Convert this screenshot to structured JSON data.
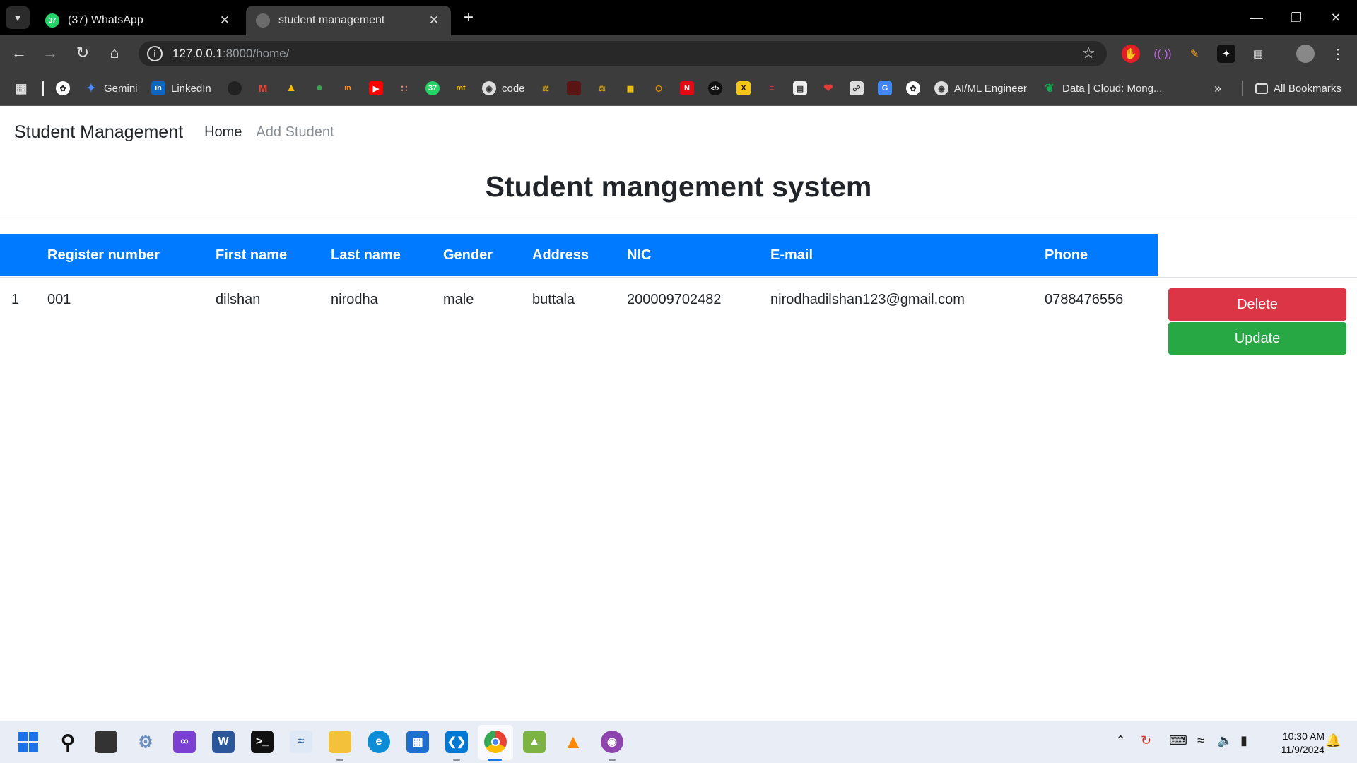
{
  "browser": {
    "tabs": [
      {
        "title": "(37) WhatsApp",
        "favicon_badge": "37",
        "favicon_color": "#25d366"
      },
      {
        "title": "student management",
        "favicon_color": "#777777"
      }
    ],
    "url_host": "127.0.0.1",
    "url_rest": ":8000/home/",
    "bookmarks": [
      {
        "label": "Gemini",
        "icon": "gemini-icon",
        "color": "#4a8cff"
      },
      {
        "label": "LinkedIn",
        "icon": "linkedin-icon",
        "color": "#0a66c2"
      },
      {
        "label": "code",
        "icon": "code-globe-icon",
        "color": "#dddddd"
      },
      {
        "label": "AI/ML Engineer",
        "icon": "ai-ml-icon",
        "color": "#dddddd"
      },
      {
        "label": "Data | Cloud: Mong...",
        "icon": "mongodb-leaf-icon",
        "color": "#13aa52"
      }
    ],
    "all_bookmarks_label": "All Bookmarks"
  },
  "navbar": {
    "brand": "Student Management",
    "links": [
      "Home",
      "Add Student"
    ]
  },
  "page": {
    "heading": "Student mangement system"
  },
  "table": {
    "headers": [
      "Register number",
      "First name",
      "Last name",
      "Gender",
      "Address",
      "NIC",
      "E-mail",
      "Phone"
    ],
    "rows": [
      {
        "index": "1",
        "register_number": "001",
        "first_name": "dilshan",
        "last_name": "nirodha",
        "gender": "male",
        "address": "buttala",
        "nic": "200009702482",
        "email": "nirodhadilshan123@gmail.com",
        "phone": "0788476556",
        "delete_label": "Delete",
        "update_label": "Update"
      }
    ]
  },
  "colors": {
    "table_header": "#007bff",
    "delete": "#dc3545",
    "update": "#28a745"
  },
  "taskbar": {
    "time": "10:30 AM",
    "date": "11/9/2024"
  }
}
